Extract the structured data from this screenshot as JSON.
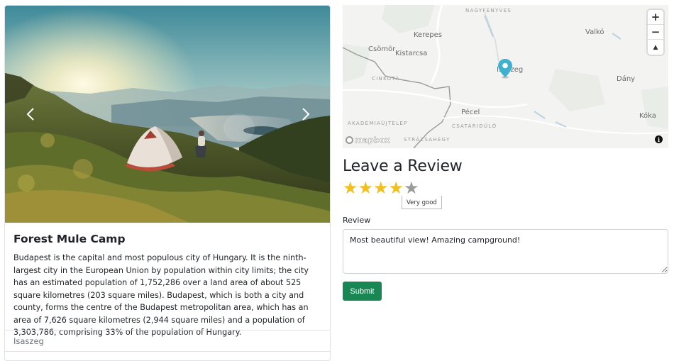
{
  "campground": {
    "title": "Forest Mule Camp",
    "description": "Budapest is the capital and most populous city of Hungary. It is the ninth-largest city in the European Union by population within city limits; the city has an estimated population of 1,752,286 over a land area of about 525 square kilometres (203 square miles). Budapest, which is both a city and county, forms the centre of the Budapest metropolitan area, which has an area of 7,626 square kilometres (2,944 square miles) and a population of 3,303,786, comprising 33% of the population of Hungary.",
    "location": "Isaszeg"
  },
  "carousel": {
    "prev_icon": "chevron-left-icon",
    "next_icon": "chevron-right-icon"
  },
  "map": {
    "labels": {
      "nagyfenyves": "NAGYFENYVES",
      "kerepes": "Kerepes",
      "valko": "Valkó",
      "csomor": "Csömör",
      "kistarcsa": "Kistarcsa",
      "cinkota": "CINKOTA",
      "isaszeg": "Isaszeg",
      "dany": "Dány",
      "pecel": "Pécel",
      "koka": "Kóka",
      "akademiaujtelep": "AKADÉMIAÚJTELEP",
      "csatarudulo": "CSATÁRIDŰLŐ",
      "strazsahegy": "STRÁZSAHEGY"
    },
    "zoom_in": "+",
    "zoom_out": "−",
    "compass": "▲",
    "logo": "mapbox",
    "info": "i",
    "pin_color": "#3fb1ce"
  },
  "review": {
    "heading": "Leave a Review",
    "rating": 4,
    "max_rating": 5,
    "rating_tooltip": "Very good",
    "label": "Review",
    "text": "Most beautiful view! Amazing campground!",
    "submit": "Submit",
    "submit_color": "#198754",
    "star_color": "#f2c01e"
  }
}
